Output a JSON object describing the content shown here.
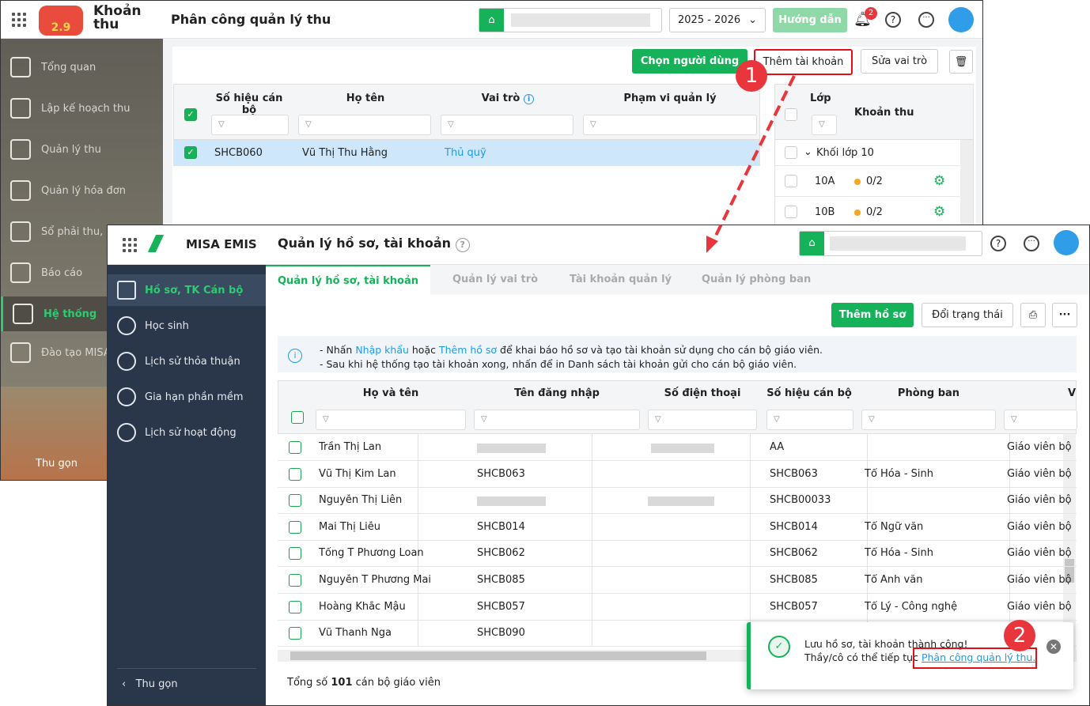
{
  "back_window": {
    "app_name": "Khoản thu",
    "logo_version": "2.9",
    "page_title": "Phân công quản lý thu",
    "school_year": "2025 - 2026",
    "guide_button": "Hướng dẫn",
    "notification_count": "2",
    "sidebar": [
      {
        "label": "Tổng quan",
        "icon": "chart-icon"
      },
      {
        "label": "Lập kế hoạch thu",
        "icon": "calendar-dollar-icon"
      },
      {
        "label": "Quản lý thu",
        "icon": "hand-coin-icon"
      },
      {
        "label": "Quản lý hóa đơn",
        "icon": "invoice-icon"
      },
      {
        "label": "Sổ phải thu, p",
        "icon": "book-icon"
      },
      {
        "label": "Báo cáo",
        "icon": "pie-icon"
      },
      {
        "label": "Hệ thống",
        "icon": "gear-icon",
        "active": true
      },
      {
        "label": "Đào tạo MISA",
        "icon": "open-book-icon"
      }
    ],
    "collapse": "Thu gọn",
    "toolbar": {
      "choose_user": "Chọn người dùng",
      "add_account": "Thêm tài khoản",
      "edit_role": "Sửa vai trò"
    },
    "table": {
      "headers": [
        "Số hiệu cán bộ",
        "Họ tên",
        "Vai trò",
        "Phạm vi quản lý"
      ],
      "rows": [
        {
          "code": "SHCB060",
          "name": "Vũ Thị Thu Hằng",
          "role": "Thủ quỹ",
          "scope": ""
        }
      ]
    },
    "class_table": {
      "headers": [
        "Lớp",
        "Khoản thu"
      ],
      "group": "Khối lớp 10",
      "rows": [
        {
          "class": "10A",
          "value": "0/2"
        },
        {
          "class": "10B",
          "value": "0/2"
        }
      ]
    }
  },
  "front_window": {
    "app_name": "MISA EMIS",
    "page_title": "Quản lý hồ sơ, tài khoản",
    "sidebar": [
      {
        "label": "Hồ sơ, TK Cán bộ",
        "icon": "profile-card-icon",
        "active": true
      },
      {
        "label": "Học sinh",
        "icon": "student-icon"
      },
      {
        "label": "Lịch sử thỏa thuận",
        "icon": "shield-star-icon"
      },
      {
        "label": "Gia hạn phần mềm",
        "icon": "renew-icon"
      },
      {
        "label": "Lịch sử hoạt động",
        "icon": "clock-icon"
      }
    ],
    "collapse": "Thu gọn",
    "tabs": [
      "Quản lý hồ sơ, tài khoản",
      "Quản lý vai trò",
      "Tài khoản quản lý",
      "Quản lý phòng ban"
    ],
    "toolbar": {
      "add_profile": "Thêm hồ sơ",
      "change_status": "Đổi trạng thái"
    },
    "info": {
      "l1_a": "- Nhấn ",
      "l1_link1": "Nhập khẩu",
      "l1_b": " hoặc ",
      "l1_link2": "Thêm hồ sơ",
      "l1_c": " để khai báo hồ sơ và tạo tài khoản sử dụng cho cán bộ giáo viên.",
      "l2": "- Sau khi hệ thống tạo tài khoản xong, nhấn để in Danh sách tài khoản gửi cho cán bộ giáo viên."
    },
    "table": {
      "headers": [
        "Họ và tên",
        "Tên đăng nhập",
        "Số điện thoại",
        "Số hiệu cán bộ",
        "Phòng ban",
        "V"
      ],
      "rows": [
        {
          "name": "Trần Thị Lan",
          "login": "",
          "phone": "",
          "code": "AA",
          "dept": "",
          "role": "Giáo viên bộ"
        },
        {
          "name": "Vũ Thị Kim Lan",
          "login": "SHCB063",
          "phone": "",
          "code": "SHCB063",
          "dept": "Tổ Hóa - Sinh",
          "role": "Giáo viên bộ"
        },
        {
          "name": "Nguyễn Thị Liên",
          "login": "",
          "phone": "",
          "code": "SHCB00033",
          "dept": "",
          "role": "Giáo viên bộ"
        },
        {
          "name": "Mai Thị Liễu",
          "login": "SHCB014",
          "phone": "",
          "code": "SHCB014",
          "dept": "Tổ Ngữ văn",
          "role": "Giáo viên bộ"
        },
        {
          "name": "Tống T Phương Loan",
          "login": "SHCB062",
          "phone": "",
          "code": "SHCB062",
          "dept": "Tổ Hóa - Sinh",
          "role": "Giáo viên bộ"
        },
        {
          "name": "Nguyễn T Phương Mai",
          "login": "SHCB085",
          "phone": "",
          "code": "SHCB085",
          "dept": "Tổ Anh văn",
          "role": "Giáo viên bộ"
        },
        {
          "name": "Hoàng Khắc Mậu",
          "login": "SHCB057",
          "phone": "",
          "code": "SHCB057",
          "dept": "Tổ Lý - Công nghệ",
          "role": "Giáo viên bộ"
        },
        {
          "name": "Vũ Thanh Nga",
          "login": "SHCB090",
          "phone": "",
          "code": "",
          "dept": "",
          "role": ""
        }
      ]
    },
    "footer": {
      "prefix": "Tổng số ",
      "count": "101",
      "suffix": " cán bộ giáo viên"
    },
    "toast": {
      "line1": "Lưu hồ sơ, tài khoản thành công!",
      "line2": "Thầy/cô có thể tiếp tục ",
      "link": "Phân công quản lý thu."
    }
  },
  "annotations": {
    "step1": "1",
    "step2": "2"
  },
  "colors": {
    "primary": "#16b25a",
    "link": "#1e9be6",
    "annotation": "#e0101a",
    "sidebar_front": "#2a374a"
  }
}
